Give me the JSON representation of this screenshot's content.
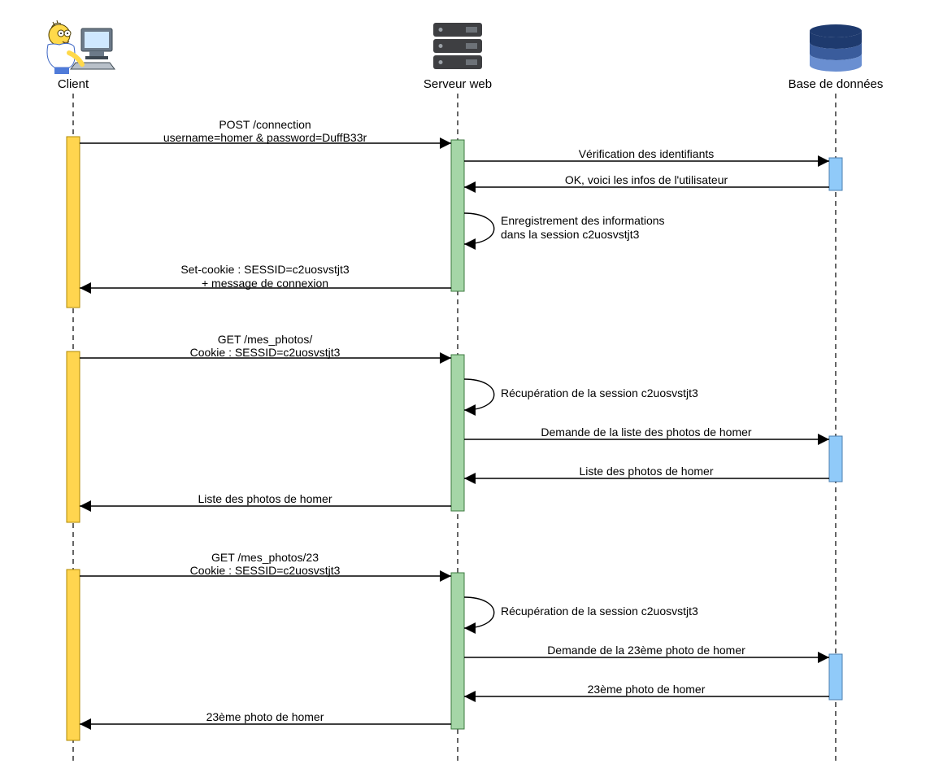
{
  "actors": {
    "client": {
      "label": "Client"
    },
    "server": {
      "label": "Serveur web"
    },
    "db": {
      "label": "Base de données"
    }
  },
  "messages": {
    "m1a": "POST /connection",
    "m1b": "username=homer & password=DuffB33r",
    "m2": "Vérification des identifiants",
    "m3": "OK, voici les infos de l'utilisateur",
    "m4a": "Enregistrement des informations",
    "m4b": "dans la session c2uosvstjt3",
    "m5a": "Set-cookie : SESSID=c2uosvstjt3",
    "m5b": "+ message de connexion",
    "m6a": "GET /mes_photos/",
    "m6b": "Cookie : SESSID=c2uosvstjt3",
    "m7": "Récupération de la session c2uosvstjt3",
    "m8": "Demande de la liste des photos de homer",
    "m9": "Liste des photos de homer",
    "m10": "Liste des photos de homer",
    "m11a": "GET /mes_photos/23",
    "m11b": "Cookie : SESSID=c2uosvstjt3",
    "m12": "Récupération de la session c2uosvstjt3",
    "m13": "Demande de la 23ème photo de homer",
    "m14": "23ème photo de homer",
    "m15": "23ème photo de homer"
  },
  "colors": {
    "client_bar": "#ffd54f",
    "server_bar": "#a5d6a7",
    "db_bar": "#90caf9",
    "db_top": "#1e3a6e",
    "db_mid": "#3a5c9c",
    "db_bot": "#6a8fd1",
    "server_icon": "#3e3f42"
  }
}
